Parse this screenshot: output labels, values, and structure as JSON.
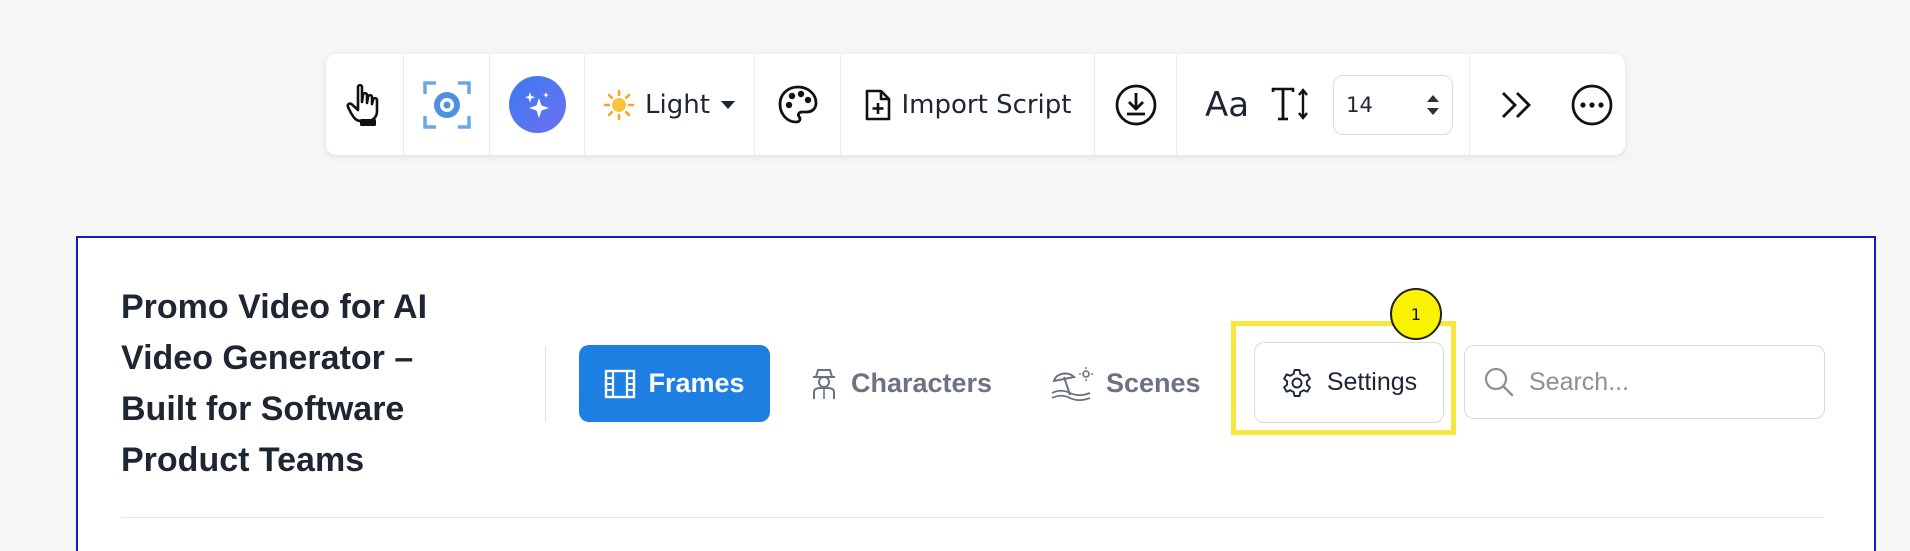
{
  "toolbar": {
    "icons": {
      "hand": "pointer-hand-icon",
      "focus": "focus-target-icon",
      "ai": "sparkles-icon",
      "palette": "palette-icon",
      "import": "file-plus-icon",
      "download": "download-circle-icon",
      "text_height": "text-height-icon",
      "more_collapse": "double-chevron-right-icon",
      "more": "ellipsis-circle-icon"
    },
    "theme_label": "Light",
    "import_label": "Import Script",
    "font_label": "Aa",
    "font_size_value": "14"
  },
  "project": {
    "title": "Promo Video for AI Video Generator – Built for Software Product Teams"
  },
  "tabs": {
    "frames": "Frames",
    "characters": "Characters",
    "scenes": "Scenes"
  },
  "settings": {
    "label": "Settings",
    "badge": "1"
  },
  "search": {
    "placeholder": "Search..."
  },
  "colors": {
    "accent": "#1e7fe3",
    "highlight": "#f6e63e",
    "badge": "#f9f300",
    "panel_border": "#1a1ab8"
  }
}
